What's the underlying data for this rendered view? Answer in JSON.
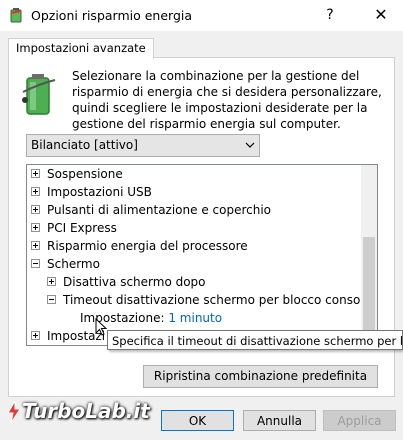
{
  "window": {
    "title": "Opzioni risparmio energia",
    "help_label": "?",
    "close_label": "✕"
  },
  "tab": {
    "label": "Impostazioni avanzate"
  },
  "description": "Selezionare la combinazione per la gestione del risparmio di energia che si desidera personalizzare, quindi scegliere le impostazioni desiderate per la gestione del risparmio energia sul computer.",
  "plan_select": {
    "value": "Bilanciato [attivo]"
  },
  "tree": {
    "items": [
      {
        "label": "Sospensione",
        "expander": "+",
        "level": 0
      },
      {
        "label": "Impostazioni USB",
        "expander": "+",
        "level": 0
      },
      {
        "label": "Pulsanti di alimentazione e coperchio",
        "expander": "+",
        "level": 0
      },
      {
        "label": "PCI Express",
        "expander": "+",
        "level": 0
      },
      {
        "label": "Risparmio energia del processore",
        "expander": "+",
        "level": 0
      },
      {
        "label": "Schermo",
        "expander": "-",
        "level": 0
      },
      {
        "label": "Disattiva schermo dopo",
        "expander": "+",
        "level": 1
      },
      {
        "label": "Timeout disattivazione schermo per blocco console",
        "expander": "-",
        "level": 1
      }
    ],
    "setting_label": "Impostazione:",
    "setting_value": "1 minuto",
    "last_item_label": "Impostazi"
  },
  "tooltip": "Specifica il timeout di disattivazione schermo per blocco console",
  "buttons": {
    "restore": "Ripristina combinazione predefinita",
    "ok": "OK",
    "cancel": "Annulla",
    "apply": "Applica"
  },
  "watermark": "TurboLab.it",
  "colors": {
    "link": "#0066cc",
    "ok_border": "#0078d7",
    "battery_green": "#4caf50"
  }
}
